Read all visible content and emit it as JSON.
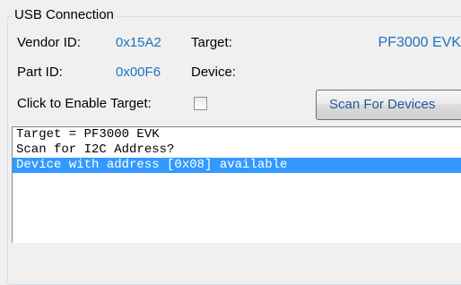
{
  "group": {
    "title": "USB Connection"
  },
  "fields": {
    "vendor_label": "Vendor ID:",
    "vendor_value": "0x15A2",
    "target_label": "Target:",
    "target_value": "PF3000 EVK",
    "part_label": "Part ID:",
    "part_value": "0x00F6",
    "device_label": "Device:"
  },
  "enable": {
    "label": "Click to Enable Target:",
    "checked": false
  },
  "scan_button": {
    "label": "Scan For Devices"
  },
  "log": {
    "lines": [
      "Target = PF3000 EVK",
      "Scan for I2C Address?",
      "Device with address [0x08] available"
    ],
    "selected_index": 2
  },
  "colors": {
    "value_blue": "#1e73be",
    "selection": "#3399ff"
  }
}
